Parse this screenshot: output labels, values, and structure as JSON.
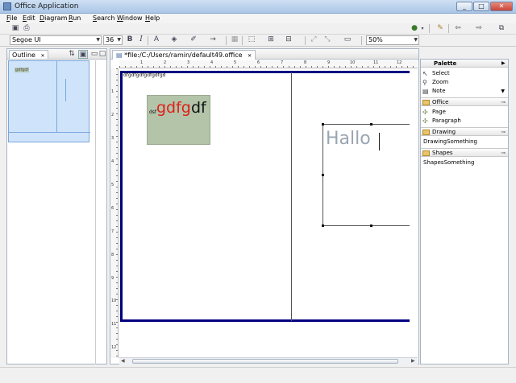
{
  "window": {
    "title": "Office Application",
    "controls": {
      "minimize": "_",
      "maximize": "□",
      "close": "✕"
    }
  },
  "menu": [
    "File",
    "Edit",
    "Diagram",
    "Run",
    "Search",
    "Window",
    "Help"
  ],
  "toolbar": {
    "font_family": "Segoe UI",
    "font_size": "36",
    "bold": "B",
    "italic": "I",
    "zoom": "50%",
    "icons": [
      "save-icon",
      "print-icon",
      "bold-icon",
      "italic-icon",
      "font-color-icon",
      "fill-color-icon",
      "line-color-icon",
      "arrow-style-icon",
      "copy-appearance-icon",
      "select-icon",
      "arrange-icon",
      "align-icon",
      "auto-size-icon",
      "link-icon",
      "grid-icon",
      "pin-icon",
      "back-icon",
      "forward-icon"
    ]
  },
  "outline": {
    "tab_label": "Outline",
    "close": "✕",
    "thumb_text": "gdfgdf"
  },
  "editor": {
    "tab_label": "*file:/C:/Users/ramin/default49.office",
    "close": "✕",
    "ruler_h": [
      "1",
      "2",
      "3",
      "4",
      "5",
      "6",
      "7",
      "8",
      "9",
      "10",
      "11",
      "12"
    ],
    "ruler_v": [
      "1",
      "2",
      "3",
      "4",
      "5",
      "6",
      "7",
      "8",
      "9",
      "10",
      "11",
      "12"
    ],
    "page_text": "dfgdfgdfgdfgdfgd",
    "box_small": "dsf",
    "box_red": "gdfg",
    "box_black": "df",
    "hallo": "Hallo"
  },
  "palette": {
    "title": "Palette",
    "tools": [
      {
        "label": "Select",
        "icon": "arrow-icon",
        "glyph": "↖"
      },
      {
        "label": "Zoom",
        "icon": "zoom-icon",
        "glyph": "⚲"
      },
      {
        "label": "Note",
        "icon": "note-icon",
        "glyph": "▤"
      }
    ],
    "office_drawer": "Office",
    "office_items": [
      {
        "label": "Page",
        "glyph": "✣"
      },
      {
        "label": "Paragraph",
        "glyph": "✣"
      }
    ],
    "drawing_drawer": "Drawing",
    "drawing_item": "DrawingSomething",
    "shapes_drawer": "Shapes",
    "shapes_item": "ShapesSomething"
  }
}
